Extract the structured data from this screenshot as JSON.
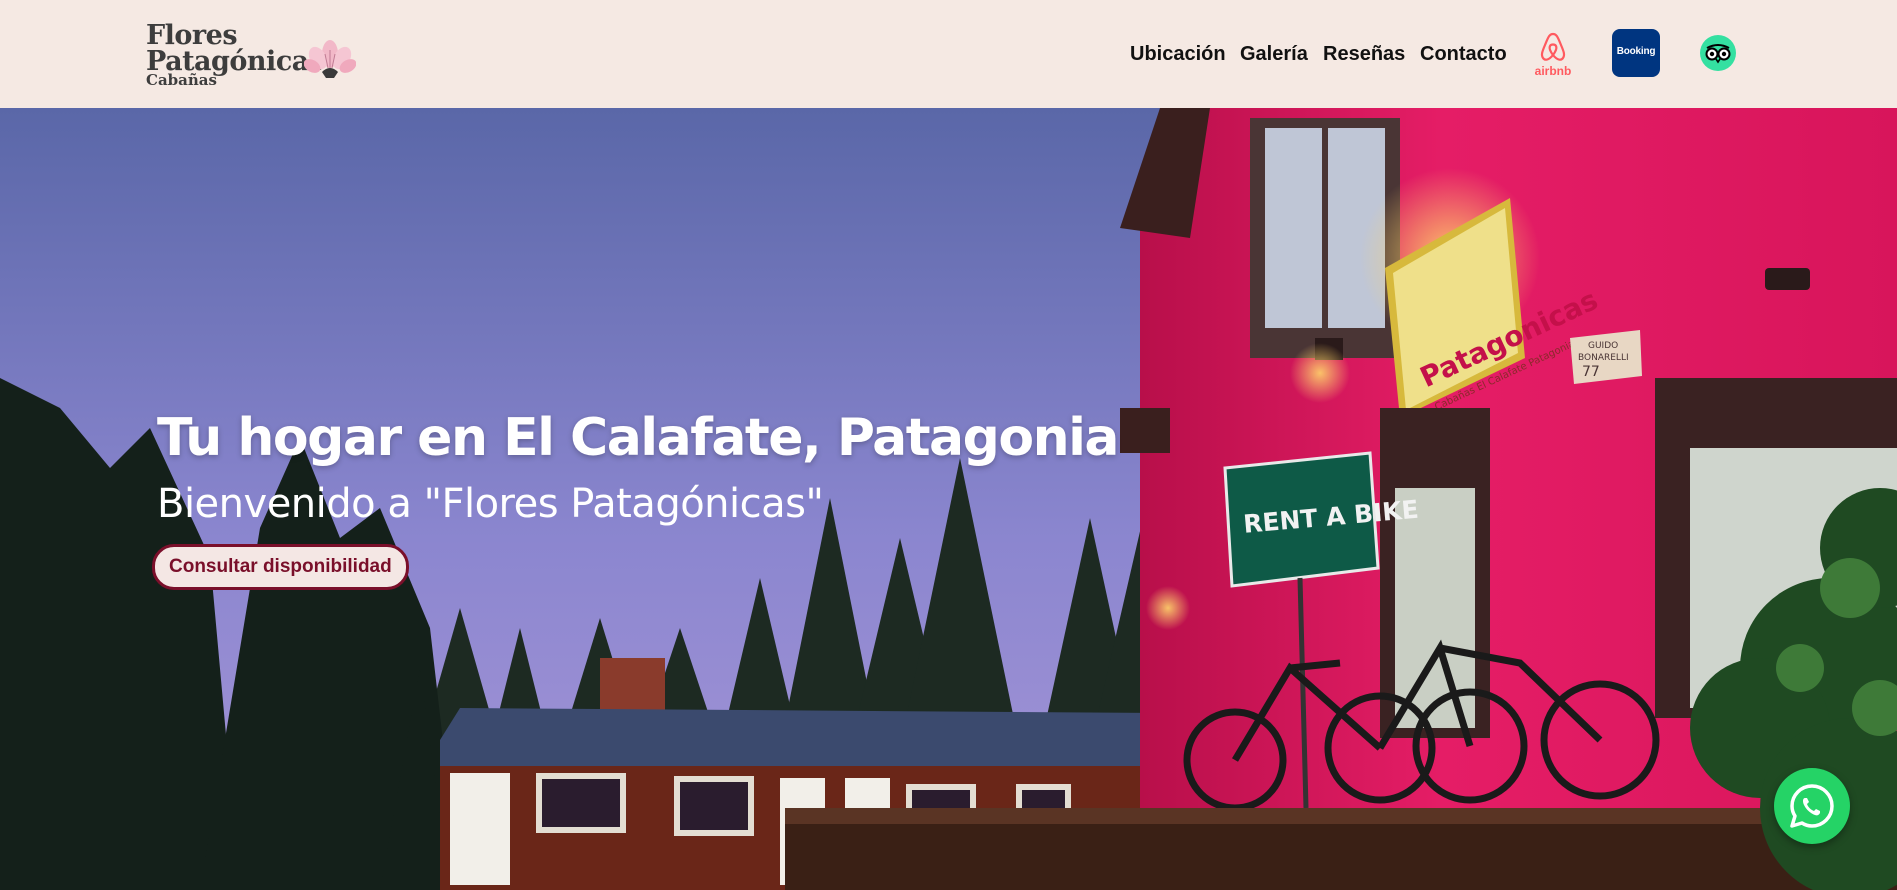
{
  "brand": {
    "line1": "Flores",
    "line2": "Patagónicas",
    "line3": "Cabañas"
  },
  "nav": {
    "items": [
      {
        "label": "Ubicación"
      },
      {
        "label": "Galería"
      },
      {
        "label": "Reseñas"
      },
      {
        "label": "Contacto"
      }
    ]
  },
  "external": {
    "airbnb_label": "airbnb",
    "booking_label": "Booking"
  },
  "hero": {
    "title": "Tu hogar en El Calafate, Patagonia",
    "subtitle": "Bienvenido a \"Flores Patagónicas\"",
    "cta_label": "Consultar disponibilidad",
    "sign_text": "RENT A BIKE",
    "building_sign_text": "Patagonicas",
    "building_sign_sub": "Cabañas El Calafate Patagonia",
    "address_plate_line1": "GUIDO",
    "address_plate_line2": "BONARELLI",
    "address_plate_number": "77"
  },
  "icons": {
    "airbnb": "airbnb-icon",
    "booking": "booking-icon",
    "tripadvisor": "tripadvisor-icon",
    "whatsapp": "whatsapp-icon"
  },
  "colors": {
    "header_bg": "#f5e9e3",
    "cta_accent": "#7a0f2a",
    "whatsapp": "#25d366",
    "airbnb": "#ff5a5f",
    "booking": "#003580",
    "tripadvisor": "#34e0a1"
  }
}
